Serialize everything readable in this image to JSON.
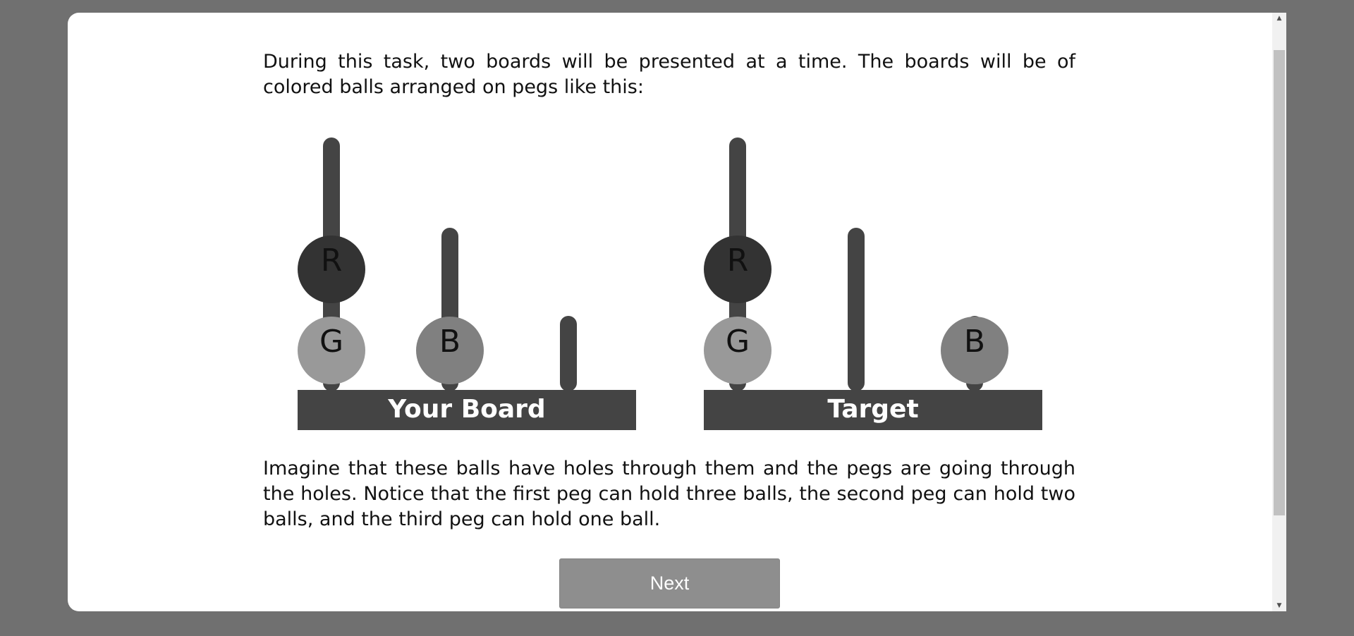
{
  "intro_text": "During this task, two boards will be presented at a time. The boards will be of colored balls arranged on pegs like this:",
  "explanation_text": "Imagine that these balls have holes through them and the pegs are going through the holes. Notice that the first peg can hold three balls, the second peg can hold two balls, and the third peg can hold one ball.",
  "boards": [
    {
      "label": "Your Board",
      "pegs": [
        [
          "G",
          "R"
        ],
        [
          "B"
        ],
        []
      ]
    },
    {
      "label": "Target",
      "pegs": [
        [
          "G",
          "R"
        ],
        [],
        [
          "B"
        ]
      ]
    }
  ],
  "peg_capacities": [
    3,
    2,
    1
  ],
  "ball_colors": {
    "R": "#333333",
    "G": "#999999",
    "B": "#808080"
  },
  "peg_color": "#444444",
  "next_button": "Next",
  "scroll_up_icon": "▲",
  "scroll_down_icon": "▼"
}
